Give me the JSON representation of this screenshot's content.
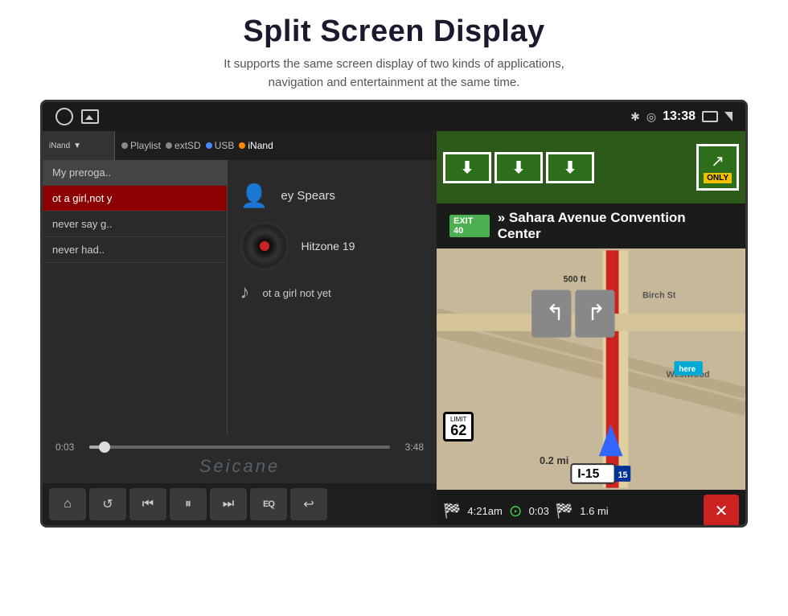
{
  "header": {
    "title": "Split Screen Display",
    "subtitle_line1": "It supports the same screen display of two kinds of applications,",
    "subtitle_line2": "navigation and entertainment at the same time."
  },
  "status_bar": {
    "time": "13:38",
    "icons": [
      "bluetooth",
      "location",
      "window",
      "back"
    ]
  },
  "music_panel": {
    "source_label": "iNand",
    "sources": [
      "Playlist",
      "extSD",
      "USB",
      "iNand"
    ],
    "playlist": [
      {
        "title": "My preroga..",
        "active": false,
        "highlight": false
      },
      {
        "title": "ot a girl,not y",
        "active": true,
        "highlight": true
      },
      {
        "title": "never say g..",
        "active": false,
        "highlight": false
      },
      {
        "title": "never had..",
        "active": false,
        "highlight": false
      }
    ],
    "now_playing": {
      "artist": "ey Spears",
      "album": "Hitzone 19",
      "song": "ot a girl not yet"
    },
    "progress": {
      "current": "0:03",
      "total": "3:48",
      "percent": 5
    },
    "watermark": "Seicane",
    "controls": [
      "home",
      "repeat",
      "prev",
      "play_pause",
      "next",
      "eq",
      "back"
    ]
  },
  "nav_panel": {
    "exit_badge": "EXIT 40",
    "direction_text": "» Sahara Avenue Convention Center",
    "distance": "0.2 mi",
    "highway": "I-15",
    "shield_num": "15",
    "speed_limit": "62",
    "speed_limit_label": "LIMIT",
    "bottom": {
      "arr_time": "4:21am",
      "elapsed": "0:03",
      "remaining_dist": "1.6 mi"
    },
    "sign_500ft": "500 ft",
    "road_label": "Birch St",
    "road_label2": "Westwood"
  },
  "icons": {
    "home": "⌂",
    "repeat": "↺",
    "prev": "⏮",
    "play_pause": "⏸",
    "next": "⏭",
    "eq": "EQ",
    "back": "↩",
    "close": "✕",
    "bluetooth": "✱",
    "location": "◎",
    "flag_start": "🏁",
    "flag_end": "🏁",
    "dot_green": "●"
  }
}
